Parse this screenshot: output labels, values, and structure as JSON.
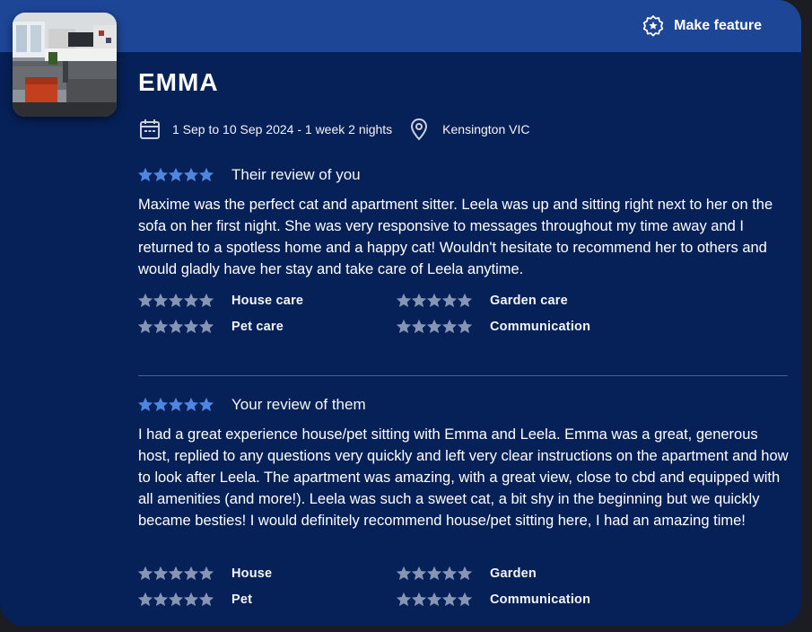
{
  "header": {
    "feature_button_label": "Make feature",
    "feature_icon": "star-badge-icon"
  },
  "host": {
    "name": "EMMA",
    "photo_alt": "living room photo"
  },
  "stay": {
    "dates": "1 Sep to 10 Sep 2024 - 1 week 2 nights",
    "location": "Kensington VIC"
  },
  "their_review": {
    "title": "Their review of you",
    "overall_rating": 5,
    "text": "Maxime was the perfect cat and apartment sitter. Leela was up and sitting right next to her on the sofa on her first night. She was very responsive to messages throughout my time away and I returned to a spotless home and a happy cat! Wouldn't hesitate to recommend her to others and would gladly have her stay and take care of Leela anytime.",
    "categories": [
      {
        "label": "House care",
        "rating": 5
      },
      {
        "label": "Garden care",
        "rating": 5
      },
      {
        "label": "Pet care",
        "rating": 5
      },
      {
        "label": "Communication",
        "rating": 5
      }
    ]
  },
  "your_review": {
    "title": "Your review of them",
    "overall_rating": 5,
    "text": "I had a great experience house/pet sitting with Emma and Leela. Emma was a great, generous host, replied to any questions very quickly and left very clear instructions on the apartment and how to look after Leela. The apartment was amazing, with a great view, close to cbd and equipped with all amenities (and more!). Leela was such a sweet cat, a bit shy in the beginning but we quickly became besties! I would definitely recommend house/pet sitting here, I had an amazing time!",
    "categories": [
      {
        "label": "House",
        "rating": 5
      },
      {
        "label": "Garden",
        "rating": 5
      },
      {
        "label": "Pet",
        "rating": 5
      },
      {
        "label": "Communication",
        "rating": 5
      }
    ]
  },
  "colors": {
    "card_bg": "#062158",
    "topbar_bg": "#1e4697",
    "overall_star": "#4f86e0",
    "sub_star": "#8795b5"
  }
}
